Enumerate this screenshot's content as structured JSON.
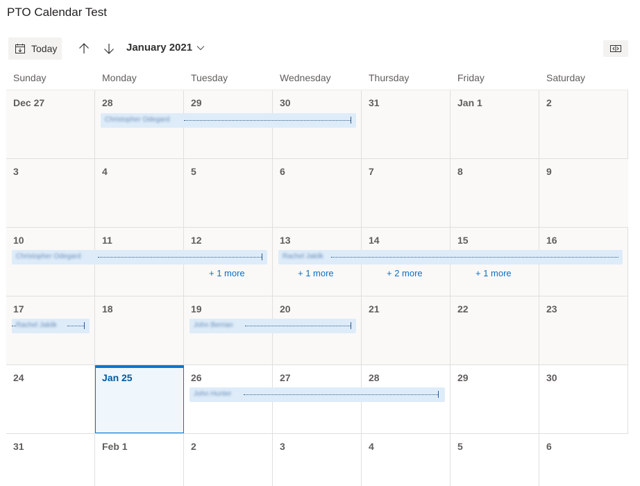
{
  "title": "PTO Calendar Test",
  "toolbar": {
    "today_label": "Today",
    "month_label": "January 2021"
  },
  "weekdays": [
    "Sunday",
    "Monday",
    "Tuesday",
    "Wednesday",
    "Thursday",
    "Friday",
    "Saturday"
  ],
  "weeks": [
    [
      "Dec 27",
      "28",
      "29",
      "30",
      "31",
      "Jan 1",
      "2"
    ],
    [
      "3",
      "4",
      "5",
      "6",
      "7",
      "8",
      "9"
    ],
    [
      "10",
      "11",
      "12",
      "13",
      "14",
      "15",
      "16"
    ],
    [
      "17",
      "18",
      "19",
      "20",
      "21",
      "22",
      "23"
    ],
    [
      "24",
      "Jan 25",
      "26",
      "27",
      "28",
      "29",
      "30"
    ],
    [
      "31",
      "Feb 1",
      "2",
      "3",
      "4",
      "5",
      "6"
    ]
  ],
  "events": [
    {
      "name": "Christopher Odegard"
    },
    {
      "name": "Christopher Odegard"
    },
    {
      "name": "Rachel Jakilk"
    },
    {
      "name": "Rachel Jakilk"
    },
    {
      "name": "John Berrian"
    },
    {
      "name": "John Hunter"
    }
  ],
  "more_links": [
    "+ 1 more",
    "+ 1 more",
    "+ 2 more",
    "+ 1 more"
  ],
  "colors": {
    "accent": "#0078d4",
    "event_bg": "#deecf9",
    "muted_day_bg": "#faf9f8",
    "today_bg": "#eff6fc"
  },
  "icons": {
    "today": "calendar-today-icon",
    "prev": "arrow-up-icon",
    "next": "arrow-down-icon",
    "month": "chevron-down-icon",
    "view": "view-switch-icon"
  }
}
